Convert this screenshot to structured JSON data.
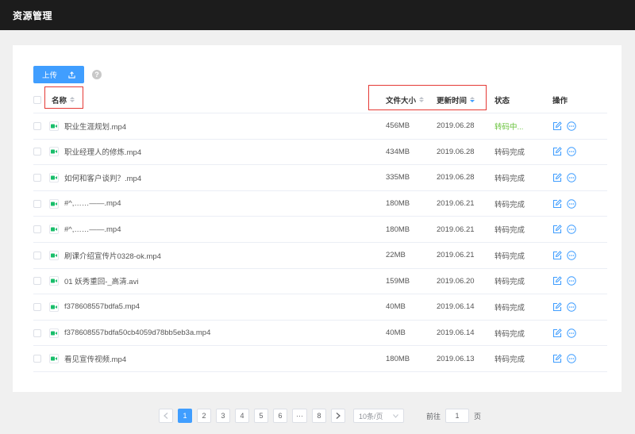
{
  "header": {
    "title": "资源管理"
  },
  "toolbar": {
    "upload_label": "上传",
    "help_icon": "?"
  },
  "table": {
    "columns": {
      "name": "名称",
      "size": "文件大小",
      "time": "更新时间",
      "status": "状态",
      "ops": "操作"
    },
    "rows": [
      {
        "name": "职业生涯规划.mp4",
        "size": "456MB",
        "time": "2019.06.28",
        "status": "转码中..."
      },
      {
        "name": "职业经理人的修炼.mp4",
        "size": "434MB",
        "time": "2019.06.28",
        "status": "转码完成"
      },
      {
        "name": "如何和客户谈判？.mp4",
        "size": "335MB",
        "time": "2019.06.28",
        "status": "转码完成"
      },
      {
        "name": "#^,……——.mp4",
        "size": "180MB",
        "time": "2019.06.21",
        "status": "转码完成"
      },
      {
        "name": "#^,……——.mp4",
        "size": "180MB",
        "time": "2019.06.21",
        "status": "转码完成"
      },
      {
        "name": "刷课介绍宣传片0328-ok.mp4",
        "size": "22MB",
        "time": "2019.06.21",
        "status": "转码完成"
      },
      {
        "name": "01 妖秀重回-_高清.avi",
        "size": "159MB",
        "time": "2019.06.20",
        "status": "转码完成"
      },
      {
        "name": "f378608557bdfa5.mp4",
        "size": "40MB",
        "time": "2019.06.14",
        "status": "转码完成"
      },
      {
        "name": "f378608557bdfa50cb4059d78bb5eb3a.mp4",
        "size": "40MB",
        "time": "2019.06.14",
        "status": "转码完成"
      },
      {
        "name": "看见宣传视频.mp4",
        "size": "180MB",
        "time": "2019.06.13",
        "status": "转码完成"
      }
    ]
  },
  "pagination": {
    "pages": [
      "1",
      "2",
      "3",
      "4",
      "5",
      "6",
      "···",
      "8"
    ],
    "current": "1",
    "page_size": "10条/页",
    "goto_label": "前往",
    "goto_value": "1",
    "page_unit": "页"
  },
  "colors": {
    "accent": "#409eff",
    "processing": "#67c23a",
    "highlight": "#e53935",
    "video": "#19be6b"
  }
}
